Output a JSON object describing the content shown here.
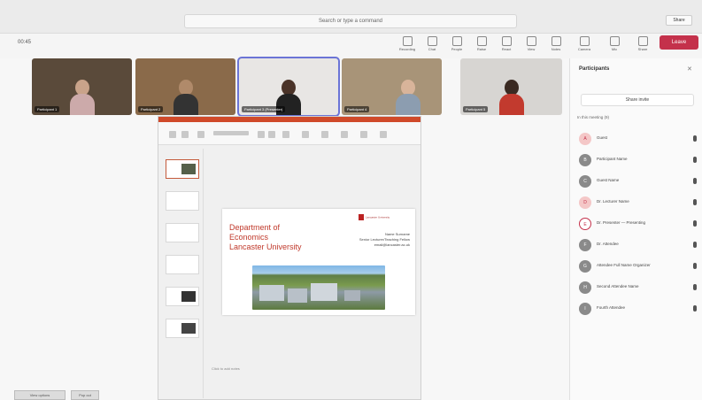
{
  "window": {
    "search_text": "Search or type a command",
    "share_label": "Share"
  },
  "toolbar": {
    "meeting_title": "00:45",
    "buttons": [
      "Recording",
      "Chat",
      "People",
      "Raise",
      "React",
      "View",
      "Notes",
      "More",
      "Camera",
      "Mic",
      "Share"
    ],
    "leave_label": "Leave"
  },
  "participants_video": [
    {
      "name": "Participant 1"
    },
    {
      "name": "Participant 2"
    },
    {
      "name": "Participant 3 (Presenter)"
    },
    {
      "name": "Participant 4"
    },
    {
      "name": "Participant 5"
    }
  ],
  "slide": {
    "title_lines": [
      "Department of",
      "Economics",
      "Lancaster University"
    ],
    "logo_text": "Lancaster University",
    "info_lines": [
      "Name Surname",
      "Senior Lecturer/Teaching Fellow",
      "email@lancaster.ac.uk"
    ],
    "notes_label": "Click to add notes"
  },
  "panel": {
    "title": "Participants",
    "invite_label": "Share invite",
    "section_label": "In this meeting (9)",
    "people": [
      {
        "initials": "A",
        "name": "Guest",
        "style": "pink"
      },
      {
        "initials": "B",
        "name": "Participant Name",
        "style": "grey"
      },
      {
        "initials": "C",
        "name": "Guest Name",
        "style": "grey"
      },
      {
        "initials": "D",
        "name": "Dr. Lecturer Name",
        "style": "pink"
      },
      {
        "initials": "E",
        "name": "Dr. Presenter — Presenting",
        "style": "ring"
      },
      {
        "initials": "F",
        "name": "Dr. Attendee",
        "style": "grey"
      },
      {
        "initials": "G",
        "name": "Attendee Full Name Organizer",
        "style": "grey"
      },
      {
        "initials": "H",
        "name": "Second Attendee Name",
        "style": "grey"
      },
      {
        "initials": "I",
        "name": "Fourth Attendee",
        "style": "grey"
      }
    ]
  },
  "bottom": {
    "left_label": "View options",
    "right_label": "Pop out"
  }
}
